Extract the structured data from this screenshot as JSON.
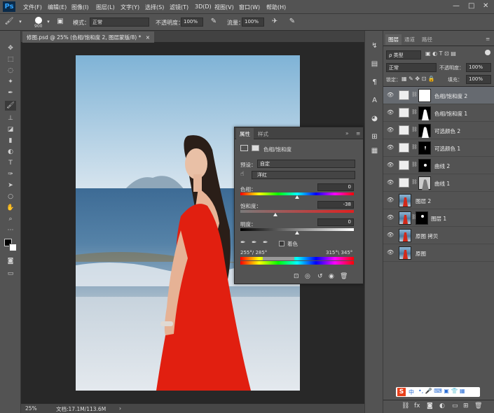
{
  "app": {
    "logo": "Ps"
  },
  "menu": [
    "文件(F)",
    "编辑(E)",
    "图像(I)",
    "图层(L)",
    "文字(Y)",
    "选择(S)",
    "滤镜(T)",
    "3D(D)",
    "视图(V)",
    "窗口(W)",
    "帮助(H)"
  ],
  "window_controls": [
    "—",
    "□",
    "✕"
  ],
  "options": {
    "brush_size": "900",
    "mode_label": "模式：",
    "mode_value": "正常",
    "opacity_label": "不透明度：",
    "opacity_value": "100%",
    "flow_label": "流量：",
    "flow_value": "100%"
  },
  "document": {
    "tab_title": "修图.psd @ 25% (色相/饱和度 2, 图层蒙版/8) *",
    "tab_close": "×",
    "zoom": "25%",
    "doc_size": "文档:17.1M/113.6M"
  },
  "layers_panel": {
    "tabs": [
      "图层",
      "通道",
      "路径"
    ],
    "filter_label": "ρ 类型",
    "blend_mode": "正常",
    "opacity_label": "不透明度：",
    "opacity_value": "100%",
    "lock_label": "锁定：",
    "fill_label": "填充：",
    "fill_value": "100%",
    "layers": [
      {
        "name": "色相/饱和度 2",
        "kind": "adjustment",
        "selected": true
      },
      {
        "name": "色相/饱和度 1",
        "kind": "adjustment",
        "selected": false
      },
      {
        "name": "可选颜色 2",
        "kind": "adjustment",
        "selected": false
      },
      {
        "name": "可选颜色 1",
        "kind": "adjustment",
        "selected": false
      },
      {
        "name": "曲线 2",
        "kind": "adjustment",
        "selected": false
      },
      {
        "name": "曲线 1",
        "kind": "adjustment",
        "selected": false
      },
      {
        "name": "图层 2",
        "kind": "pixel",
        "selected": false
      },
      {
        "name": "图层 1",
        "kind": "pixel",
        "selected": false
      },
      {
        "name": "原图 拷贝",
        "kind": "pixel",
        "selected": false
      },
      {
        "name": "原图",
        "kind": "pixel",
        "selected": false
      }
    ],
    "footer_icons": [
      "link-icon",
      "fx-icon",
      "mask-icon",
      "adjustment-icon",
      "group-icon",
      "new-layer-icon",
      "delete-icon"
    ],
    "ime_text": "中"
  },
  "properties_panel": {
    "tabs": [
      "属性",
      "样式"
    ],
    "title": "色相/饱和度",
    "preset_label": "预设：",
    "preset_value": "自定",
    "channel_value": "洋红",
    "hue_label": "色相：",
    "hue_value": "0",
    "hue": 0,
    "saturation_label": "饱和度：",
    "saturation_value": "-38",
    "saturation": -38,
    "lightness_label": "明度：",
    "lightness_value": "0",
    "lightness": 0,
    "colorize_label": "着色",
    "range_left": "255°/ 285°",
    "range_right": "315°\\ 345°"
  },
  "colors": {
    "accent": "#2fa3ff",
    "panel_bg": "#535353",
    "canvas_bg": "#282828",
    "selected_layer": "#666a70"
  }
}
